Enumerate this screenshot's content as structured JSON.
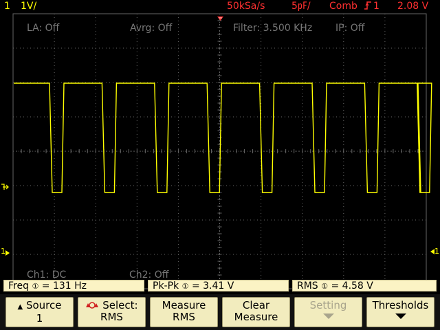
{
  "header": {
    "channel": "1",
    "scale": "1V/",
    "sample_rate": "50kSa/s",
    "timebase": "5㎊/",
    "mode": "Comb",
    "trigger_icon": "trigger-rising-edge-icon",
    "trigger_source": "1",
    "trigger_level": "2.08 V"
  },
  "overlay": {
    "la": "LA: Off",
    "avrg": "Avrg: Off",
    "filter": "Filter: 3.500 KHz",
    "ip": "IP: Off",
    "ch1": "Ch1: DC",
    "ch2": "Ch2: Off"
  },
  "markers": {
    "trigger_position_icon": "trigger-position-marker-icon",
    "trigger_level_icon": "trigger-level-marker-icon",
    "ch1_ground_label": "1",
    "ground_icon": "ground-marker-icon",
    "right_marker_label": "1"
  },
  "measurements": [
    {
      "label": "Freq",
      "icon": "channel-1-icon",
      "value": "= 131 Hz"
    },
    {
      "label": "Pk-Pk",
      "icon": "channel-1-icon",
      "value": "=  3.41 V"
    },
    {
      "label": "RMS",
      "icon": "channel-1-icon",
      "value": "=  4.58 V"
    }
  ],
  "softkeys": [
    {
      "line1": "Source",
      "line2": "1",
      "icon": "up-triangle-icon",
      "enabled": true
    },
    {
      "line1": "Select:",
      "line2": "RMS",
      "icon": "select-knob-icon",
      "enabled": true
    },
    {
      "line1": "Measure",
      "line2": "RMS",
      "enabled": true
    },
    {
      "line1": "Clear",
      "line2": "Measure",
      "enabled": true
    },
    {
      "line1": "Setting",
      "line2": "",
      "icon": "down-arrow-icon",
      "enabled": false
    },
    {
      "line1": "Thresholds",
      "line2": "",
      "icon": "down-arrow-icon",
      "enabled": true
    }
  ],
  "colors": {
    "channel1": "#ffff00",
    "header_red": "#ff3030",
    "grid": "#666666",
    "softkey_bg": "#f2ecbe",
    "measurement_bg": "#fbf3c4"
  },
  "trace": {
    "channel": "1",
    "pulse_count": 8,
    "waveform": "square-pulse-train"
  }
}
